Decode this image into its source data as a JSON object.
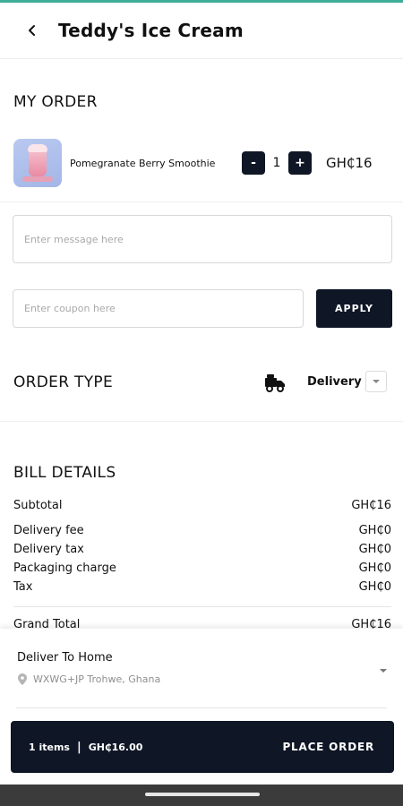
{
  "header": {
    "title": "Teddy's Ice Cream",
    "back_icon": "arrow-left-icon"
  },
  "my_order": {
    "title": "MY ORDER",
    "item": {
      "name": "Pomegranate Berry Smoothie",
      "quantity": "1",
      "price": "GH₵16",
      "minus_label": "-",
      "plus_label": "+"
    }
  },
  "message": {
    "placeholder": "Enter message here",
    "value": ""
  },
  "coupon": {
    "placeholder": "Enter coupon here",
    "value": "",
    "apply_label": "APPLY"
  },
  "order_type": {
    "title": "ORDER TYPE",
    "selected": "Delivery",
    "icon": "delivery-truck-icon"
  },
  "bill": {
    "title": "BILL DETAILS",
    "rows": [
      {
        "label": "Subtotal",
        "value": "GH₵16"
      },
      {
        "label": "Delivery fee",
        "value": "GH₵0"
      },
      {
        "label": "Delivery tax",
        "value": "GH₵0"
      },
      {
        "label": "Packaging charge",
        "value": "GH₵0"
      },
      {
        "label": "Tax",
        "value": "GH₵0"
      },
      {
        "label": "Grand Total",
        "value": "GH₵16"
      }
    ]
  },
  "delivery": {
    "title": "Deliver To Home",
    "address": "WXWG+JP Trohwe, Ghana"
  },
  "footer": {
    "items_text": "1 items",
    "separator": "|",
    "total": "GH₵16.00",
    "place_order_label": "PLACE ORDER"
  },
  "colors": {
    "accent": "#3fae99",
    "dark": "#0f1626",
    "nav_bar": "#3b3b3b"
  }
}
